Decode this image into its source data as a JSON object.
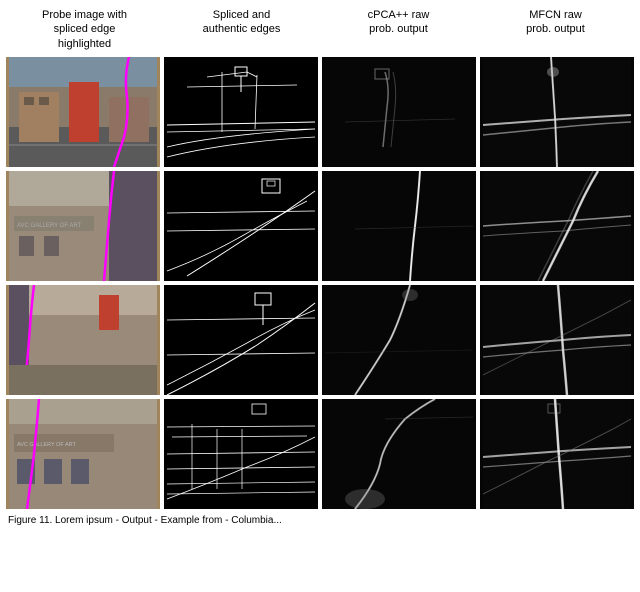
{
  "headers": [
    {
      "id": "col1",
      "label": "Probe image with\nspliced edge\nhighlighted"
    },
    {
      "id": "col2",
      "label": "Spliced and\nauthentic edges"
    },
    {
      "id": "col3",
      "label": "cPCA++ raw\nprob. output"
    },
    {
      "id": "col4",
      "label": "MFCN raw\nprob. output"
    }
  ],
  "caption": "Figure 11. Lorem ipsum - Output - Example from - Columbia...",
  "rows": [
    {
      "id": "row1"
    },
    {
      "id": "row2"
    },
    {
      "id": "row3"
    },
    {
      "id": "row4"
    }
  ],
  "colors": {
    "background": "#ffffff",
    "text": "#000000",
    "imageBlack": "#000000"
  }
}
